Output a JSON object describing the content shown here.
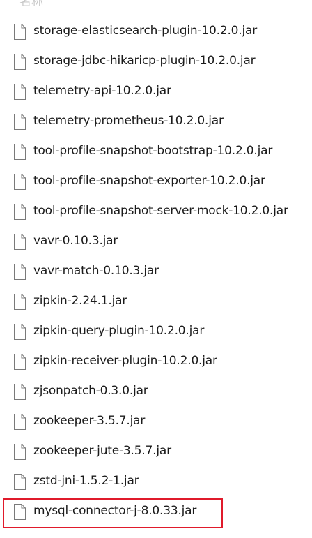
{
  "header": {
    "partial_label": "名称"
  },
  "files": [
    {
      "name": "storage-elasticsearch-plugin-10.2.0.jar",
      "icon": "file-icon"
    },
    {
      "name": "storage-jdbc-hikaricp-plugin-10.2.0.jar",
      "icon": "file-icon"
    },
    {
      "name": "telemetry-api-10.2.0.jar",
      "icon": "file-icon"
    },
    {
      "name": "telemetry-prometheus-10.2.0.jar",
      "icon": "file-icon"
    },
    {
      "name": "tool-profile-snapshot-bootstrap-10.2.0.jar",
      "icon": "file-icon"
    },
    {
      "name": "tool-profile-snapshot-exporter-10.2.0.jar",
      "icon": "file-icon"
    },
    {
      "name": "tool-profile-snapshot-server-mock-10.2.0.jar",
      "icon": "file-icon"
    },
    {
      "name": "vavr-0.10.3.jar",
      "icon": "file-icon"
    },
    {
      "name": "vavr-match-0.10.3.jar",
      "icon": "file-icon"
    },
    {
      "name": "zipkin-2.24.1.jar",
      "icon": "file-icon"
    },
    {
      "name": "zipkin-query-plugin-10.2.0.jar",
      "icon": "file-icon"
    },
    {
      "name": "zipkin-receiver-plugin-10.2.0.jar",
      "icon": "file-icon"
    },
    {
      "name": "zjsonpatch-0.3.0.jar",
      "icon": "file-icon"
    },
    {
      "name": "zookeeper-3.5.7.jar",
      "icon": "file-icon"
    },
    {
      "name": "zookeeper-jute-3.5.7.jar",
      "icon": "file-icon"
    },
    {
      "name": "zstd-jni-1.5.2-1.jar",
      "icon": "file-icon"
    },
    {
      "name": "mysql-connector-j-8.0.33.jar",
      "icon": "file-icon",
      "highlighted": true
    }
  ],
  "colors": {
    "highlight_border": "#e01a2b",
    "text": "#1b1b1b",
    "icon_stroke": "#7a7a7a"
  }
}
